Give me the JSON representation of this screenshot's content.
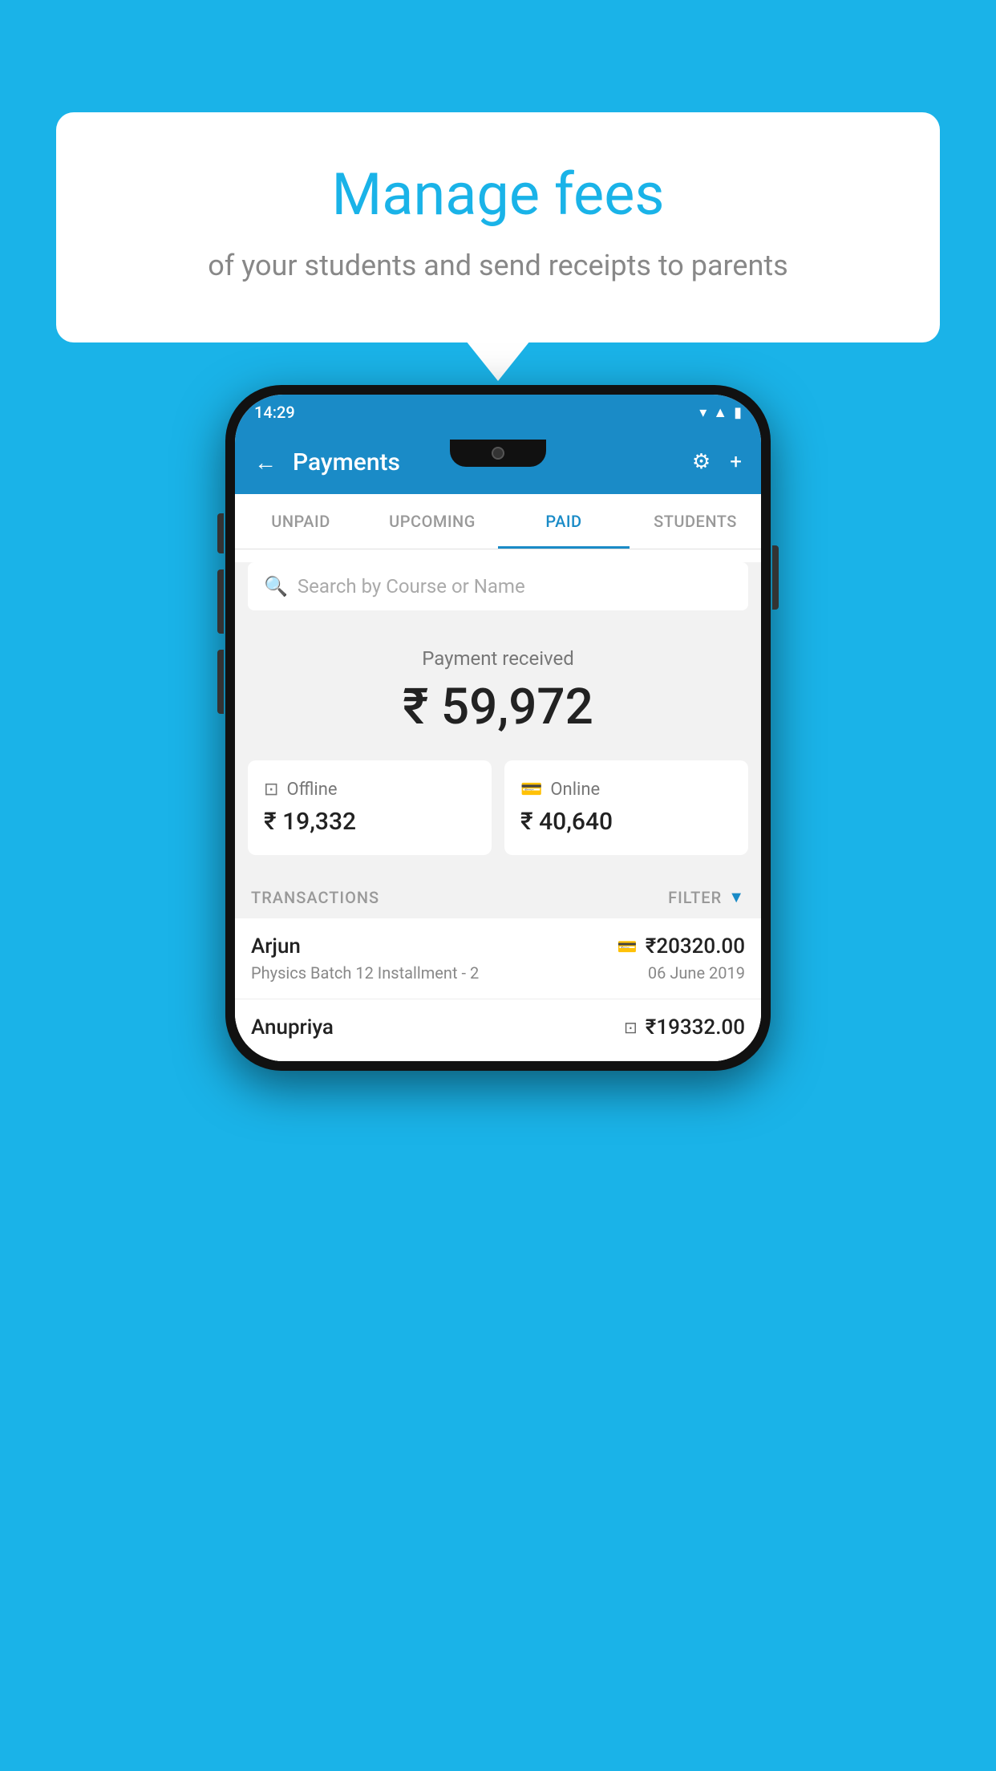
{
  "background_color": "#1ab3e8",
  "bubble": {
    "title": "Manage fees",
    "subtitle": "of your students and send receipts to parents"
  },
  "phone": {
    "status_bar": {
      "time": "14:29",
      "icons": [
        "wifi",
        "signal",
        "battery"
      ]
    },
    "app_bar": {
      "title": "Payments",
      "back_label": "←",
      "settings_label": "⚙",
      "add_label": "+"
    },
    "tabs": [
      {
        "label": "UNPAID",
        "active": false
      },
      {
        "label": "UPCOMING",
        "active": false
      },
      {
        "label": "PAID",
        "active": true
      },
      {
        "label": "STUDENTS",
        "active": false
      }
    ],
    "search": {
      "placeholder": "Search by Course or Name"
    },
    "payment_received": {
      "label": "Payment received",
      "amount": "₹ 59,972"
    },
    "payment_cards": [
      {
        "icon": "💳",
        "label": "Offline",
        "amount": "₹ 19,332"
      },
      {
        "icon": "💳",
        "label": "Online",
        "amount": "₹ 40,640"
      }
    ],
    "transactions_header": {
      "label": "TRANSACTIONS",
      "filter_label": "FILTER"
    },
    "transactions": [
      {
        "name": "Arjun",
        "course": "Physics Batch 12 Installment - 2",
        "amount": "₹20320.00",
        "date": "06 June 2019",
        "payment_type": "online"
      },
      {
        "name": "Anupriya",
        "course": "",
        "amount": "₹19332.00",
        "date": "",
        "payment_type": "offline"
      }
    ]
  }
}
